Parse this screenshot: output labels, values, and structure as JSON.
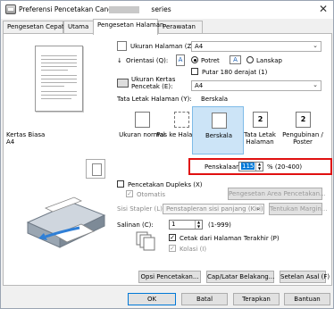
{
  "window": {
    "title_prefix": "Preferensi Pencetakan Canon",
    "title_suffix": "series"
  },
  "tabs": [
    "Pengesetan Cepat",
    "Utama",
    "Pengesetan Halaman",
    "Perawatan"
  ],
  "preview": {
    "media_type": "Kertas Biasa",
    "paper_size": "A4"
  },
  "page_size": {
    "label": "Ukuran Halaman (Z):",
    "value": "A4"
  },
  "orientation": {
    "label": "Orientasi (Q):",
    "portrait": "Potret",
    "landscape": "Lanskap",
    "rotate180": "Putar 180 derajat (1)"
  },
  "printer_paper": {
    "label_line1": "Ukuran Kertas",
    "label_line2": "Pencetak (E):",
    "value": "A4"
  },
  "layout": {
    "label": "Tata Letak Halaman (Y):",
    "current": "Berskala",
    "options": [
      {
        "label": "Ukuran normal"
      },
      {
        "label": "Pas ke Halaman"
      },
      {
        "label": "Berskala"
      },
      {
        "label": "Tata Letak Halaman",
        "badge": "2"
      },
      {
        "label": "Pengubinan / Poster",
        "badge": "2"
      }
    ]
  },
  "scaling": {
    "label": "Penskalaan:",
    "value": "115",
    "range": "% (20-400)"
  },
  "duplex": {
    "label": "Pencetakan Dupleks (X)",
    "auto": "Otomatis",
    "area_button": "Pengesetan Area Pencetakan...",
    "stapling_label": "Sisi Stapler (L):",
    "stapling_value": "Penstapleran sisi panjang (Kiri)",
    "margin_button": "Tentukan Margin..."
  },
  "copies": {
    "label": "Salinan (C):",
    "value": "1",
    "range": "(1-999)",
    "last_page_first": "Cetak dari Halaman Terakhir (P)",
    "collate": "Kolasi (I)"
  },
  "bottom_buttons": {
    "print_options": "Opsi Pencetakan...",
    "stamp_background": "Cap/Latar Belakang...",
    "defaults": "Setelan Asal (F)"
  },
  "dialog_buttons": {
    "ok": "OK",
    "cancel": "Batal",
    "apply": "Terapkan",
    "help": "Bantuan"
  },
  "colors": {
    "highlight": "#0078d7",
    "red_box": "#e01010"
  }
}
